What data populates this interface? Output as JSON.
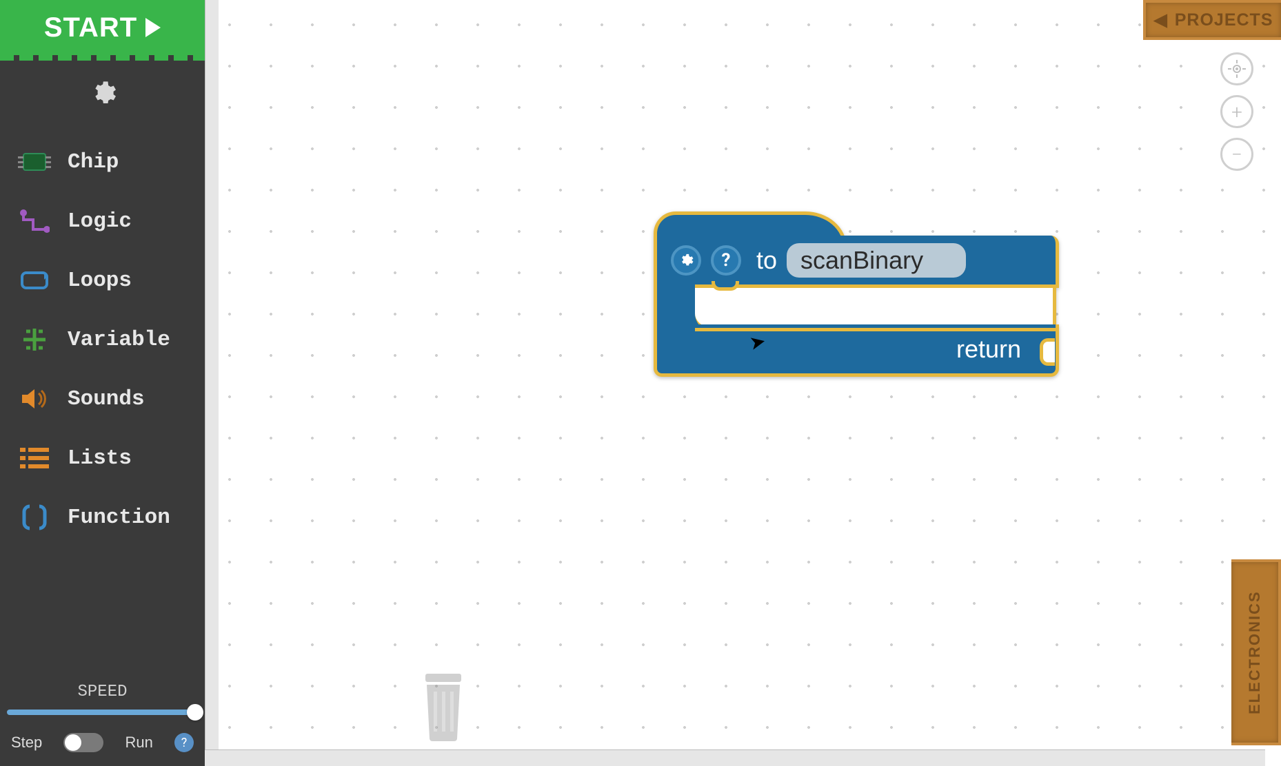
{
  "sidebar": {
    "start": "START",
    "categories": [
      {
        "id": "chip",
        "label": "Chip",
        "color": "#2e8b57"
      },
      {
        "id": "logic",
        "label": "Logic",
        "color": "#a15bc2"
      },
      {
        "id": "loops",
        "label": "Loops",
        "color": "#3b8bc9"
      },
      {
        "id": "variable",
        "label": "Variable",
        "color": "#4aa03f"
      },
      {
        "id": "sounds",
        "label": "Sounds",
        "color": "#e28a2b"
      },
      {
        "id": "lists",
        "label": "Lists",
        "color": "#e28a2b"
      },
      {
        "id": "function",
        "label": "Function",
        "color": "#3b8bc9"
      }
    ],
    "speed_label": "SPEED",
    "step_label": "Step",
    "run_label": "Run"
  },
  "tabs": {
    "projects": "PROJECTS",
    "electronics": "ELECTRONICS"
  },
  "block": {
    "to_label": "to",
    "func_name": "scanBinary",
    "return_label": "return"
  },
  "icons": {
    "gear": "gear-icon",
    "play": "play-icon",
    "help": "?",
    "center": "center-icon",
    "plus": "+",
    "minus": "−"
  }
}
